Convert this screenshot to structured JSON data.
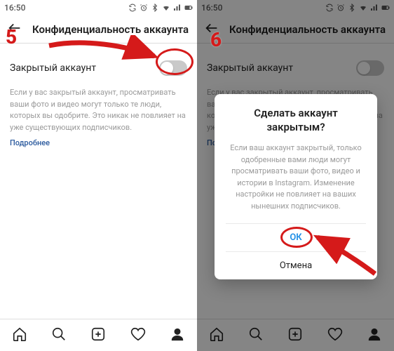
{
  "statusbar": {
    "time": "16:50"
  },
  "header": {
    "title": "Конфиденциальность аккаунта"
  },
  "private_account": {
    "label": "Закрытый аккаунт",
    "description": "Если у вас закрытый аккаунт, просматривать ваши фото и видео могут только те люди, которых вы одобрите. Это никак не повлияет на уже существующих подписчиков.",
    "more_label": "Подробнее"
  },
  "dialog": {
    "title": "Сделать аккаунт закрытым?",
    "body": "Если ваш аккаунт закрытый, только одобренные вами люди могут просматривать ваши фото, видео и истории в Instagram. Изменение настройки не повлияет на ваших нынешних подписчиков.",
    "ok_label": "ОК",
    "cancel_label": "Отмена"
  },
  "annotations": {
    "step5": "5",
    "step6": "6"
  },
  "colors": {
    "highlight": "#d51a1a",
    "link": "#2b5a9e",
    "dialog_ok": "#1f8fe6"
  }
}
